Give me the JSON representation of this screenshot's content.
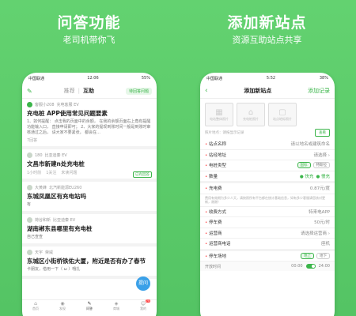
{
  "left": {
    "title": "问答功能",
    "subtitle": "老司机带你飞",
    "status": {
      "carrier": "中国联通",
      "time": "12:06",
      "battery": "55%"
    },
    "nav": {
      "tab1": "推荐",
      "tab2": "互助",
      "pending": "待回答问题"
    },
    "posts": [
      {
        "author": "客服小208",
        "role": "充电客服 EV",
        "title": "充电桩 APP使用常见问题要素",
        "body": "1、如何提醒： 点击我的页面中的余额， 在我的余额页面右上角有提醒功能输入口， 直接申请即可； 2、大家的提现到账时间一般是到账时审核通过之后， 请大家不要紧张， 都会在...",
        "stats": "7回答"
      },
      {
        "author": "180",
        "role": "比亚迪秦 EV",
        "title": "文昌市新建n处充电桩",
        "stats1": "1小时前",
        "stats2": "1关注",
        "stats3": "未读问题",
        "badge": "已有回答"
      },
      {
        "author": "大黄蜂",
        "role": "北汽新能源EU260",
        "title": "东城凤凰区有充电站吗",
        "body": "有"
      },
      {
        "author": "荷谷和新",
        "role": "比亚迪秦 EV",
        "title": "湖南郴东县哪里有充电桩",
        "body": "自己查查"
      },
      {
        "author": "天宇",
        "role": "荣威",
        "title": "东城区小街桥铁佑大厦，附近是否有办了春节",
        "body": "卡朋友，借用一下（ ω ）哦扎"
      }
    ],
    "fab": "提问",
    "bottom_nav": [
      {
        "label": "首页",
        "icon": "⌂"
      },
      {
        "label": "发现",
        "icon": "◉"
      },
      {
        "label": "问答",
        "icon": "✎"
      },
      {
        "label": "商城",
        "icon": "◈"
      },
      {
        "label": "我的",
        "icon": "☺",
        "badge": "75"
      }
    ]
  },
  "right": {
    "title": "添加新站点",
    "subtitle": "资源互助站点共享",
    "status": {
      "carrier": "中国联通",
      "time": "5:52",
      "battery": "38%"
    },
    "nav": {
      "title": "添加新站点",
      "record": "添加记录"
    },
    "photos": [
      {
        "label": "电站整体照片",
        "icon": "▦"
      },
      {
        "label": "充电桩照片",
        "icon": "⌂"
      },
      {
        "label": "站点地标照片",
        "icon": "▢"
      }
    ],
    "addr_hint": "照片地点：请按显示记录",
    "addr_btn": "查看",
    "rows": [
      {
        "label": "站点名称",
        "value": "请以地名或建筑命名"
      },
      {
        "label": "站经地址",
        "value": "请选择 ›"
      },
      {
        "label": "电桩类型",
        "opt1": "国标",
        "opt2": "特斯拉"
      },
      {
        "label": "数量",
        "opt1": "● 快充",
        "opt2": "● 慢充"
      },
      {
        "label": "充电费",
        "value": "0.87元/度"
      },
      {
        "label": "收费方式",
        "value": "特来电APP"
      },
      {
        "label": "停车费",
        "value": "50元/时"
      },
      {
        "label": "运营商",
        "value": "请选择运营商 ›"
      },
      {
        "label": "运营商电话",
        "value": "座机"
      },
      {
        "label": "停车场地",
        "opt1": "地上",
        "opt2": "地下"
      }
    ],
    "hint": "费用有效期为多少人天，请按照所有平台都在统计基础信息，如有多少客服请您核对更新，谢谢！",
    "time_row": {
      "label": "开放时间",
      "start": "00:00",
      "end": "24:00"
    }
  }
}
